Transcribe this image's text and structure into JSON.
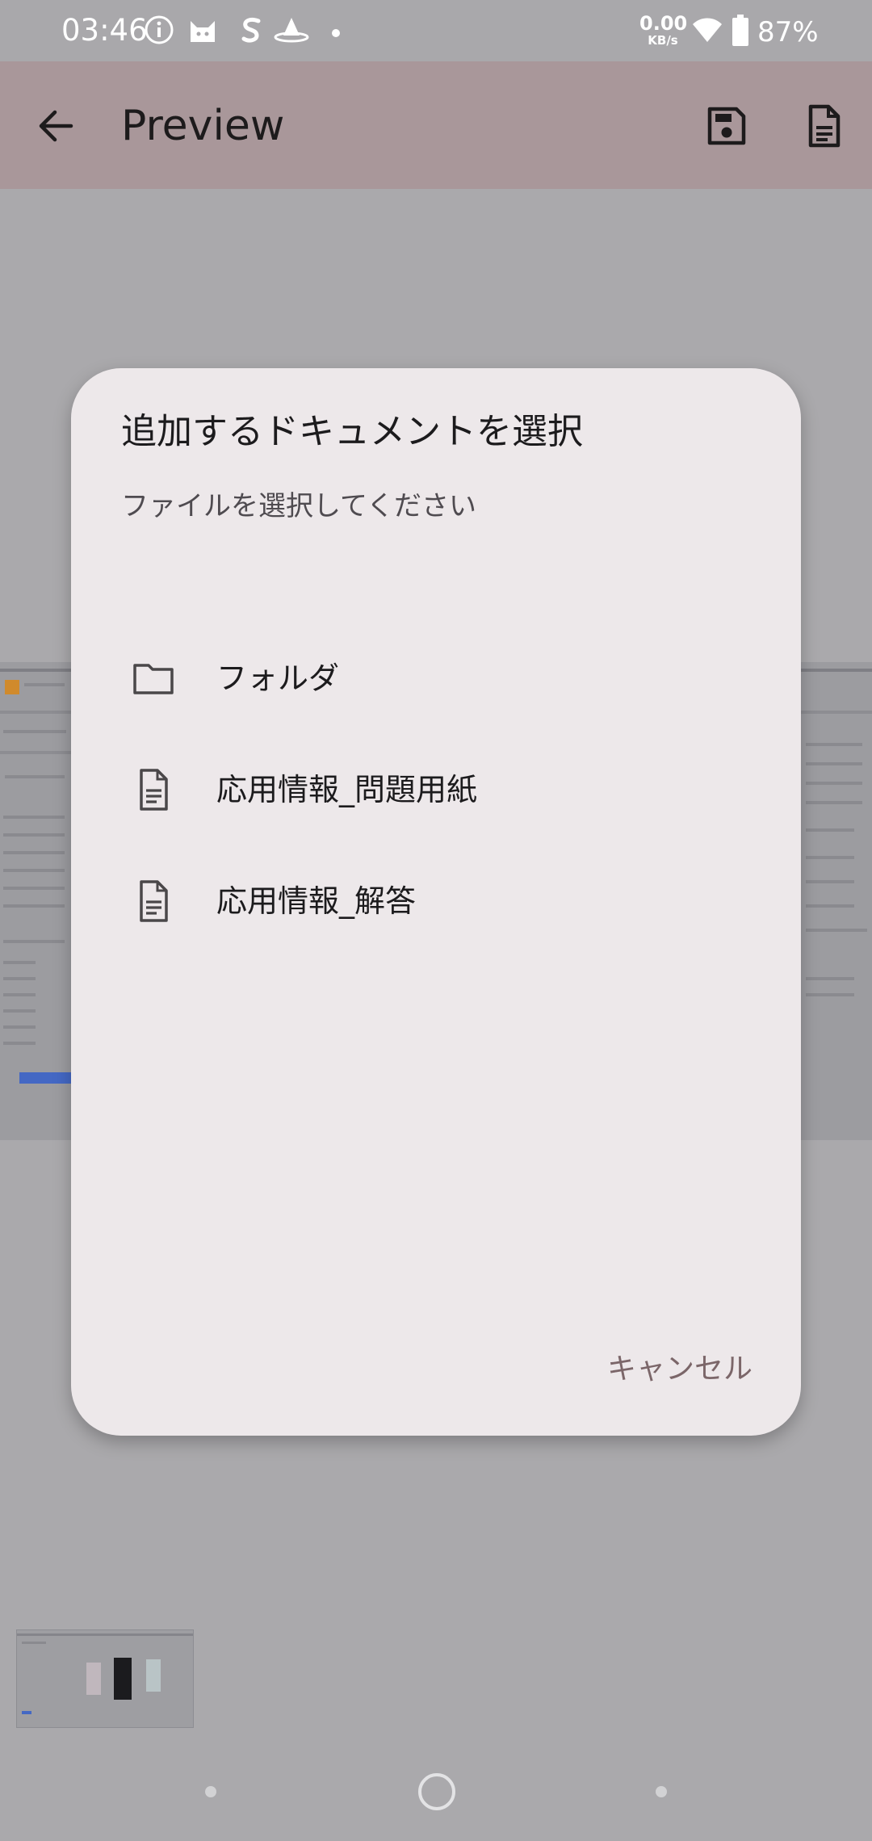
{
  "status_bar": {
    "time": "03:46",
    "net_speed_value": "0.00",
    "net_speed_unit": "KB/s",
    "battery_percent": "87%",
    "icons": [
      "info-icon",
      "cat-app-icon",
      "s-app-icon",
      "hat-app-icon",
      "dot-icon",
      "wifi-icon",
      "battery-icon"
    ]
  },
  "app_bar": {
    "title": "Preview",
    "back_icon": "arrow-left-icon",
    "save_icon": "floppy-disk-icon",
    "document_icon": "document-icon"
  },
  "dialog": {
    "title": "追加するドキュメントを選択",
    "subtitle": "ファイルを選択してください",
    "items": [
      {
        "label": "フォルダ",
        "icon": "folder-icon"
      },
      {
        "label": "応用情報_問題用紙",
        "icon": "document-icon"
      },
      {
        "label": "応用情報_解答",
        "icon": "document-icon"
      }
    ],
    "cancel_label": "キャンセル"
  },
  "colors": {
    "scrim": "#aaa9ac",
    "app_bar": "#a9979a",
    "dialog_bg": "#ede8ea",
    "cancel_text": "#7b6669"
  }
}
